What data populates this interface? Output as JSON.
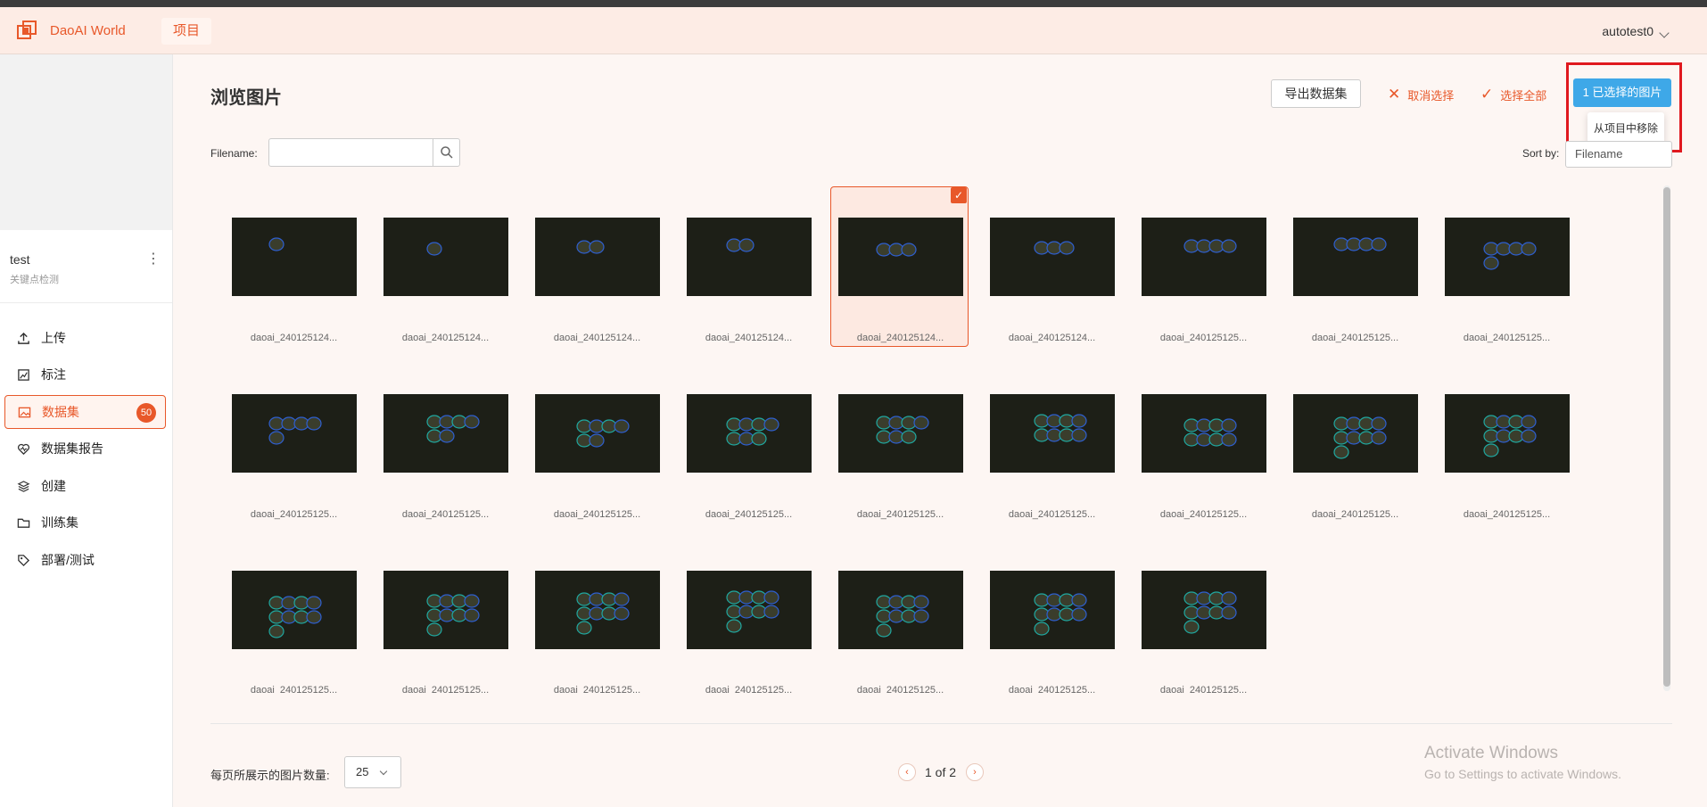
{
  "header": {
    "brand": "DaoAI World",
    "nav_tab": "项目",
    "user": "autotest0"
  },
  "sidebar": {
    "project_name": "test",
    "project_sub": "关键点检测",
    "items": [
      {
        "label": "上传",
        "icon": "upload-icon"
      },
      {
        "label": "标注",
        "icon": "annotate-icon"
      },
      {
        "label": "数据集",
        "icon": "image-icon",
        "active": true,
        "badge": "50"
      },
      {
        "label": "数据集报告",
        "icon": "heart-pulse-icon"
      },
      {
        "label": "创建",
        "icon": "layers-icon"
      },
      {
        "label": "训练集",
        "icon": "folder-icon"
      },
      {
        "label": "部署/测试",
        "icon": "tag-icon"
      }
    ]
  },
  "main": {
    "title": "浏览图片",
    "export_label": "导出数据集",
    "deselect_label": "取消选择",
    "select_all_label": "选择全部",
    "selected_label": "1 已选择的图片",
    "dropdown_item": "从项目中移除",
    "filename_label": "Filename:",
    "search_value": "",
    "sort_label": "Sort by:",
    "sort_value": "Filename"
  },
  "images": [
    {
      "label": "daoai_240125124...",
      "selected": false
    },
    {
      "label": "daoai_240125124...",
      "selected": false
    },
    {
      "label": "daoai_240125124...",
      "selected": false
    },
    {
      "label": "daoai_240125124...",
      "selected": false
    },
    {
      "label": "daoai_240125124...",
      "selected": true
    },
    {
      "label": "daoai_240125124...",
      "selected": false
    },
    {
      "label": "daoai_240125125...",
      "selected": false
    },
    {
      "label": "daoai_240125125...",
      "selected": false
    },
    {
      "label": "daoai_240125125...",
      "selected": false
    },
    {
      "label": "daoai_240125125...",
      "selected": false
    },
    {
      "label": "daoai_240125125...",
      "selected": false
    },
    {
      "label": "daoai_240125125...",
      "selected": false
    },
    {
      "label": "daoai_240125125...",
      "selected": false
    },
    {
      "label": "daoai_240125125...",
      "selected": false
    },
    {
      "label": "daoai_240125125...",
      "selected": false
    },
    {
      "label": "daoai_240125125...",
      "selected": false
    },
    {
      "label": "daoai_240125125...",
      "selected": false
    },
    {
      "label": "daoai_240125125...",
      "selected": false
    },
    {
      "label": "daoai_240125125...",
      "selected": false
    },
    {
      "label": "daoai_240125125...",
      "selected": false
    },
    {
      "label": "daoai_240125125...",
      "selected": false
    },
    {
      "label": "daoai_240125125...",
      "selected": false
    },
    {
      "label": "daoai_240125125...",
      "selected": false
    },
    {
      "label": "daoai_240125125...",
      "selected": false
    },
    {
      "label": "daoai_240125125...",
      "selected": false
    }
  ],
  "footer": {
    "per_page_label": "每页所展示的图片数量:",
    "per_page_value": "25",
    "page_text": "1 of 2",
    "activate_title": "Activate Windows",
    "activate_sub": "Go to Settings to activate Windows."
  },
  "colors": {
    "accent": "#e8582a",
    "primary": "#3ea8e8",
    "highlight": "#e0191f"
  }
}
